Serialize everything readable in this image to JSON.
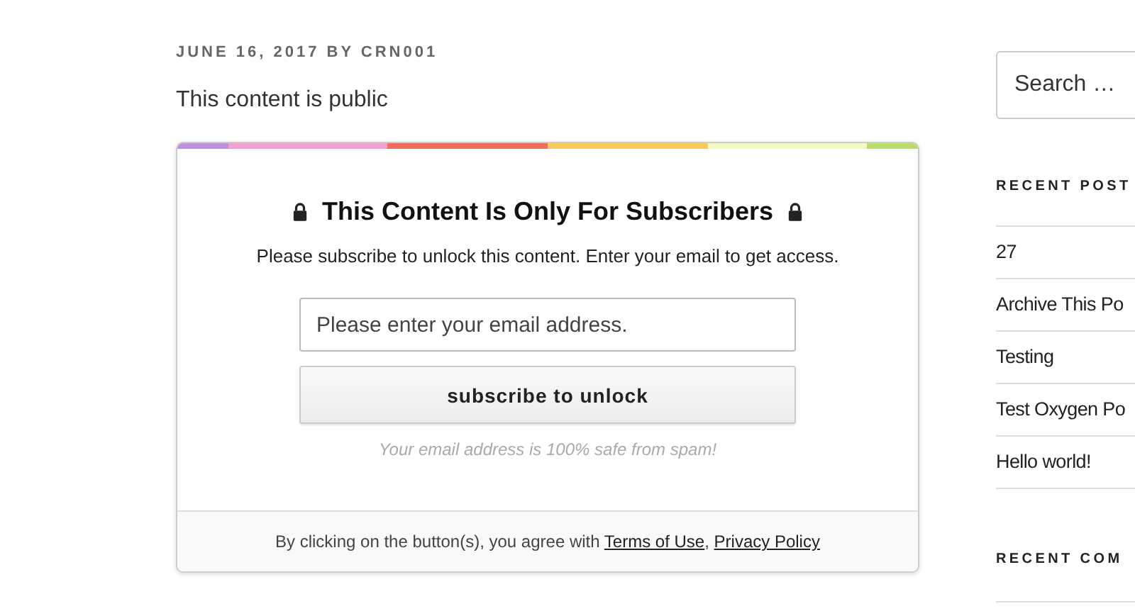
{
  "post": {
    "meta": "JUNE 16, 2017 BY CRN001",
    "intro": "This content is public"
  },
  "locker": {
    "title": "This Content Is Only For Subscribers",
    "message": "Please subscribe to unlock this content. Enter your email to get access.",
    "email_field": {
      "placeholder": "Please enter your email address."
    },
    "button": "subscribe to unlock",
    "note": "Your email address is 100% safe from spam!",
    "footer": {
      "text": "By clicking on the button(s), you agree with",
      "links": [
        "Terms of Use",
        "Privacy Policy"
      ],
      "separator": ","
    }
  },
  "sidebar": {
    "search": {
      "placeholder": "Search …"
    },
    "recent_posts": {
      "heading": "RECENT POST",
      "items": [
        "27",
        "Archive This Po",
        "Testing",
        "Test Oxygen Po",
        "Hello world!"
      ]
    },
    "recent_comments": {
      "heading": "RECENT COM"
    }
  }
}
